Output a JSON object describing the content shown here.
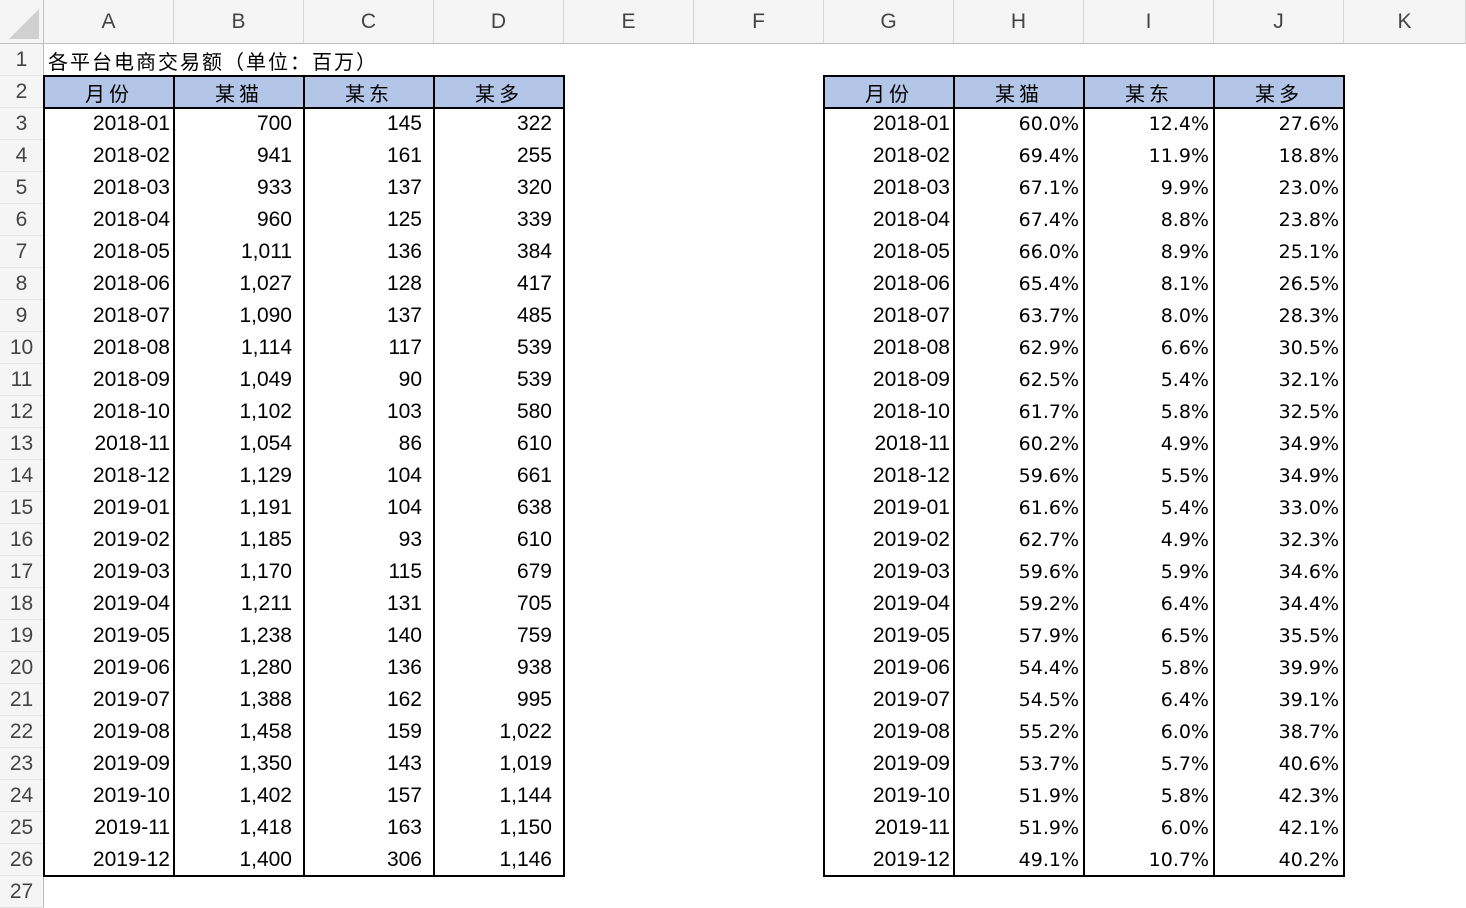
{
  "columns": [
    "A",
    "B",
    "C",
    "D",
    "E",
    "F",
    "G",
    "H",
    "I",
    "J",
    "K"
  ],
  "rows": [
    "1",
    "2",
    "3",
    "4",
    "5",
    "6",
    "7",
    "8",
    "9",
    "10",
    "11",
    "12",
    "13",
    "14",
    "15",
    "16",
    "17",
    "18",
    "19",
    "20",
    "21",
    "22",
    "23",
    "24",
    "25",
    "26",
    "27"
  ],
  "title": "各平台电商交易额（单位：百万）",
  "left_table": {
    "headers": [
      "月份",
      "某猫",
      "某东",
      "某多"
    ],
    "rows": [
      [
        "2018-01",
        "700",
        "145",
        "322"
      ],
      [
        "2018-02",
        "941",
        "161",
        "255"
      ],
      [
        "2018-03",
        "933",
        "137",
        "320"
      ],
      [
        "2018-04",
        "960",
        "125",
        "339"
      ],
      [
        "2018-05",
        "1,011",
        "136",
        "384"
      ],
      [
        "2018-06",
        "1,027",
        "128",
        "417"
      ],
      [
        "2018-07",
        "1,090",
        "137",
        "485"
      ],
      [
        "2018-08",
        "1,114",
        "117",
        "539"
      ],
      [
        "2018-09",
        "1,049",
        "90",
        "539"
      ],
      [
        "2018-10",
        "1,102",
        "103",
        "580"
      ],
      [
        "2018-11",
        "1,054",
        "86",
        "610"
      ],
      [
        "2018-12",
        "1,129",
        "104",
        "661"
      ],
      [
        "2019-01",
        "1,191",
        "104",
        "638"
      ],
      [
        "2019-02",
        "1,185",
        "93",
        "610"
      ],
      [
        "2019-03",
        "1,170",
        "115",
        "679"
      ],
      [
        "2019-04",
        "1,211",
        "131",
        "705"
      ],
      [
        "2019-05",
        "1,238",
        "140",
        "759"
      ],
      [
        "2019-06",
        "1,280",
        "136",
        "938"
      ],
      [
        "2019-07",
        "1,388",
        "162",
        "995"
      ],
      [
        "2019-08",
        "1,458",
        "159",
        "1,022"
      ],
      [
        "2019-09",
        "1,350",
        "143",
        "1,019"
      ],
      [
        "2019-10",
        "1,402",
        "157",
        "1,144"
      ],
      [
        "2019-11",
        "1,418",
        "163",
        "1,150"
      ],
      [
        "2019-12",
        "1,400",
        "306",
        "1,146"
      ]
    ]
  },
  "right_table": {
    "headers": [
      "月份",
      "某猫",
      "某东",
      "某多"
    ],
    "rows": [
      [
        "2018-01",
        "60.0%",
        "12.4%",
        "27.6%"
      ],
      [
        "2018-02",
        "69.4%",
        "11.9%",
        "18.8%"
      ],
      [
        "2018-03",
        "67.1%",
        "9.9%",
        "23.0%"
      ],
      [
        "2018-04",
        "67.4%",
        "8.8%",
        "23.8%"
      ],
      [
        "2018-05",
        "66.0%",
        "8.9%",
        "25.1%"
      ],
      [
        "2018-06",
        "65.4%",
        "8.1%",
        "26.5%"
      ],
      [
        "2018-07",
        "63.7%",
        "8.0%",
        "28.3%"
      ],
      [
        "2018-08",
        "62.9%",
        "6.6%",
        "30.5%"
      ],
      [
        "2018-09",
        "62.5%",
        "5.4%",
        "32.1%"
      ],
      [
        "2018-10",
        "61.7%",
        "5.8%",
        "32.5%"
      ],
      [
        "2018-11",
        "60.2%",
        "4.9%",
        "34.9%"
      ],
      [
        "2018-12",
        "59.6%",
        "5.5%",
        "34.9%"
      ],
      [
        "2019-01",
        "61.6%",
        "5.4%",
        "33.0%"
      ],
      [
        "2019-02",
        "62.7%",
        "4.9%",
        "32.3%"
      ],
      [
        "2019-03",
        "59.6%",
        "5.9%",
        "34.6%"
      ],
      [
        "2019-04",
        "59.2%",
        "6.4%",
        "34.4%"
      ],
      [
        "2019-05",
        "57.9%",
        "6.5%",
        "35.5%"
      ],
      [
        "2019-06",
        "54.4%",
        "5.8%",
        "39.9%"
      ],
      [
        "2019-07",
        "54.5%",
        "6.4%",
        "39.1%"
      ],
      [
        "2019-08",
        "55.2%",
        "6.0%",
        "38.7%"
      ],
      [
        "2019-09",
        "53.7%",
        "5.7%",
        "40.6%"
      ],
      [
        "2019-10",
        "51.9%",
        "5.8%",
        "42.3%"
      ],
      [
        "2019-11",
        "51.9%",
        "6.0%",
        "42.1%"
      ],
      [
        "2019-12",
        "49.1%",
        "10.7%",
        "40.2%"
      ]
    ]
  },
  "colors": {
    "header_fill": "#b4c6e7",
    "grid_header_bg": "#f5f5f5"
  }
}
